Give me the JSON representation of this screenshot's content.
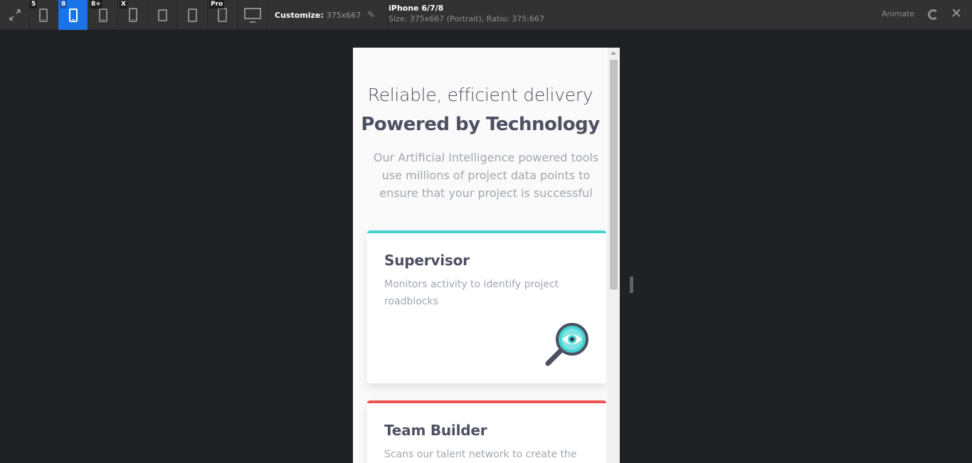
{
  "toolbar": {
    "devices": [
      {
        "badge": "",
        "name": "fit"
      },
      {
        "badge": "5"
      },
      {
        "badge": "8",
        "active": true
      },
      {
        "badge": "8+"
      },
      {
        "badge": "X"
      },
      {
        "badge": ""
      },
      {
        "badge": ""
      },
      {
        "badge": "Pro"
      },
      {
        "badge": ""
      }
    ],
    "customize_label": "Customize:",
    "customize_value": "375x667",
    "device_name": "iPhone 6/7/8",
    "device_size": "Size: 375x667 (Portrait), Ratio: 375:667",
    "animate_label": "Animate"
  },
  "page": {
    "hero_light": "Reliable, efficient delivery",
    "hero_bold": "Powered by Technology",
    "hero_description": "Our Artificial Intelligence powered tools use millions of project data points to ensure that your project is successful",
    "cards": [
      {
        "title": "Supervisor",
        "description": "Monitors activity to identify project roadblocks",
        "accent": "#45d3d3",
        "icon": "magnifier-eye-icon"
      },
      {
        "title": "Team Builder",
        "description": "Scans our talent network to create the",
        "accent": "#ea5454"
      }
    ]
  },
  "colors": {
    "toolbar_bg": "#323232",
    "active_blue": "#1a73e8",
    "page_bg": "#202124",
    "heading": "#4d5061",
    "muted": "#a3a6b3"
  }
}
